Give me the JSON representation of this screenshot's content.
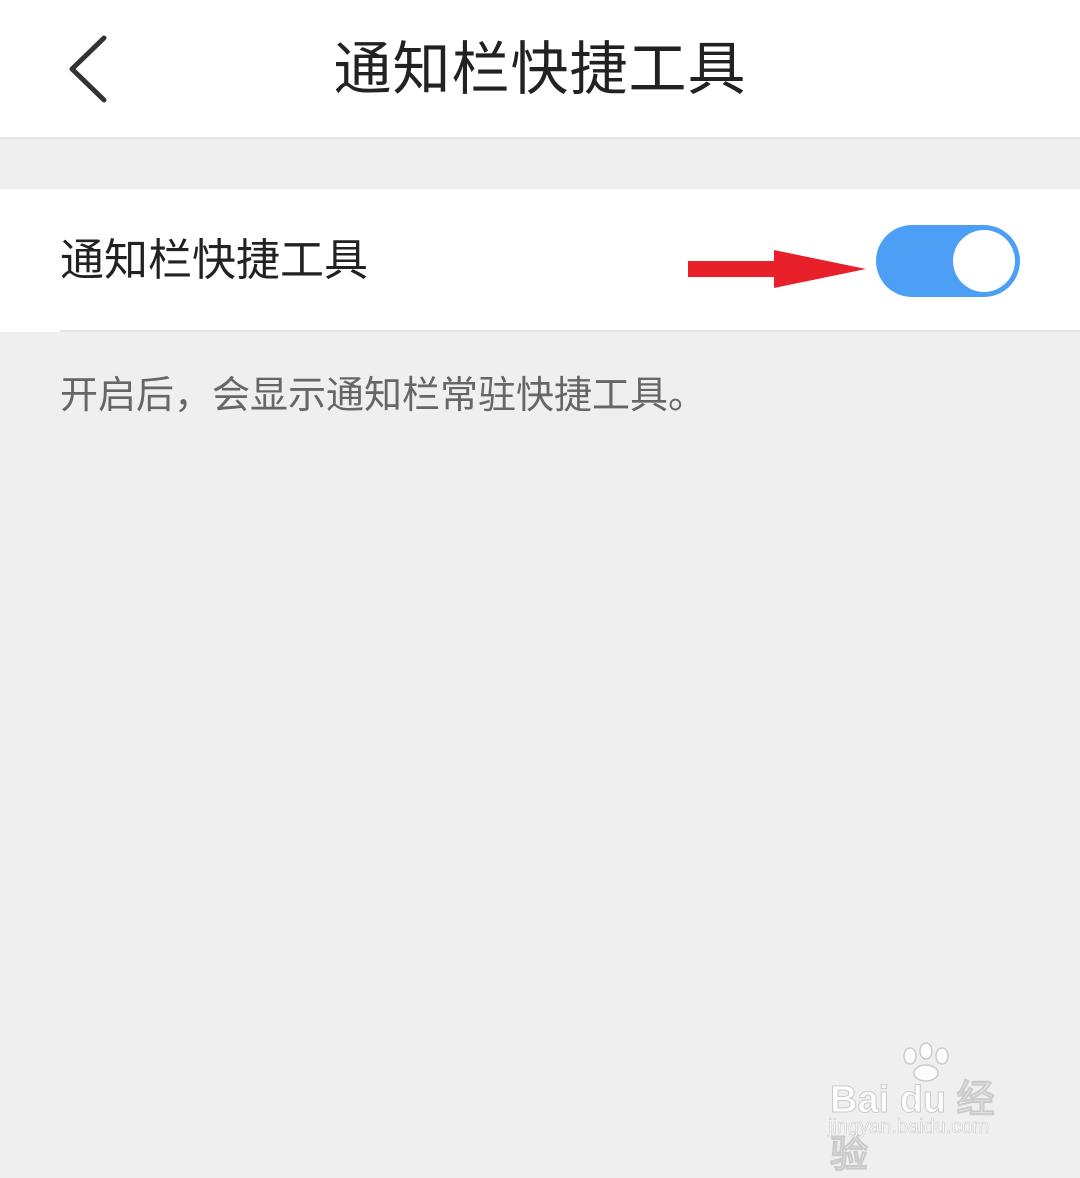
{
  "header": {
    "title": "通知栏快捷工具",
    "back_icon": "chevron-left-icon"
  },
  "setting": {
    "label": "通知栏快捷工具",
    "enabled": true,
    "toggle_color": "#4c9ff5",
    "description": "开启后，会显示通知栏常驻快捷工具。"
  },
  "annotation": {
    "arrow_color": "#e8202a"
  },
  "watermark": {
    "brand": "Bai du 经验",
    "url": "jingyan.baidu.com"
  }
}
